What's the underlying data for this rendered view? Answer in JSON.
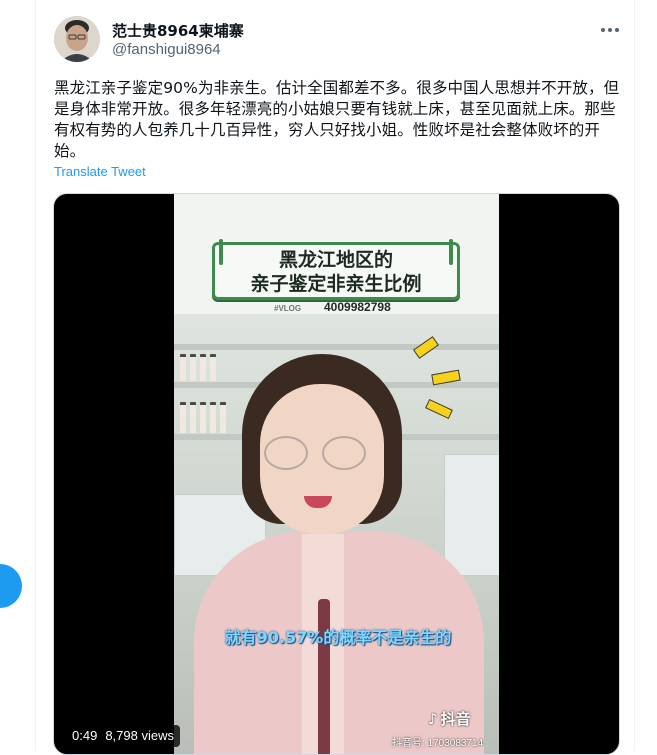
{
  "tweet": {
    "display_name": "范士贵8964柬埔寨",
    "handle": "@fanshigui8964",
    "more_icon": "more-horizontal-icon",
    "text": "黑龙江亲子鉴定90%为非亲生。估计全国都差不多。很多中国人思想并不开放，但是身体非常开放。很多年轻漂亮的小姑娘只要有钱就上床，甚至见面就上床。那些有权有势的人包养几十几百异性，穷人只好找小姐。性败坏是社会整体败坏的开始。",
    "translate_label": "Translate Tweet"
  },
  "video": {
    "title_line1": "黑龙江地区的",
    "title_line2": "亲子鉴定非亲生比例",
    "vlog_tag": "#VLOG",
    "phone": "4009982798",
    "subtitle": "就有90.57%的概率不是亲生的",
    "watermark_logo": "抖音",
    "watermark_id": "抖音号: 1703083714",
    "duration": "0:49",
    "views": "8,798 views"
  },
  "colors": {
    "link_blue": "#1d9bf0",
    "text_primary": "#0f1419",
    "text_secondary": "#536471",
    "title_card_border": "#3f8a4d",
    "subtitle_cyan": "#7fd6ff"
  }
}
